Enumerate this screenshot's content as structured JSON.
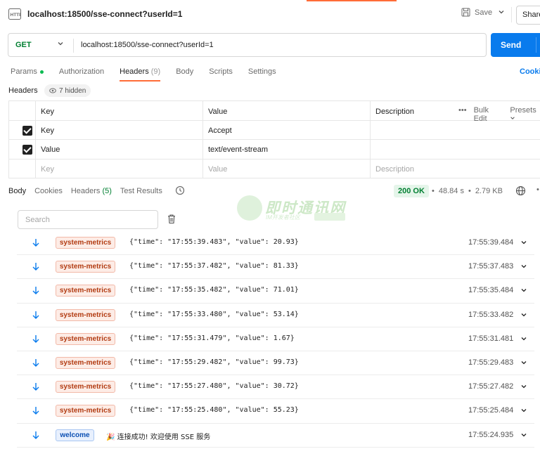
{
  "request": {
    "title": "localhost:18500/sse-connect?userId=1",
    "save_label": "Save",
    "share_label": "Share",
    "method": "GET",
    "url": "localhost:18500/sse-connect?userId=1",
    "send_label": "Send"
  },
  "req_tabs": [
    {
      "label": "Params",
      "count": "",
      "dot": true
    },
    {
      "label": "Authorization",
      "count": ""
    },
    {
      "label": "Headers",
      "count": "(9)",
      "active": true
    },
    {
      "label": "Body",
      "count": ""
    },
    {
      "label": "Scripts",
      "count": ""
    },
    {
      "label": "Settings",
      "count": ""
    }
  ],
  "cookies_label": "Cookie",
  "headers_section": {
    "label": "Headers",
    "hidden": "7 hidden",
    "columns": {
      "key": "Key",
      "value": "Value",
      "description": "Description"
    },
    "bulk_edit": "Bulk Edit",
    "presets": "Presets",
    "rows": [
      {
        "key": "Key",
        "value": "Accept",
        "checked": true
      },
      {
        "key": "Value",
        "value": "text/event-stream",
        "checked": true
      }
    ],
    "placeholder": {
      "key": "Key",
      "value": "Value",
      "description": "Description"
    }
  },
  "response": {
    "tabs": [
      {
        "label": "Body",
        "count": ""
      },
      {
        "label": "Cookies",
        "count": ""
      },
      {
        "label": "Headers",
        "count": "(5)"
      },
      {
        "label": "Test Results",
        "count": ""
      }
    ],
    "status": "200 OK",
    "time": "48.84 s",
    "size": "2.79 KB",
    "search_placeholder": "Search"
  },
  "watermark": {
    "text": "即时通讯网",
    "sub": "IM开发者社区"
  },
  "events": [
    {
      "type": "system-metrics",
      "data": "{\"time\": \"17:55:39.483\", \"value\": 20.93}",
      "time": "17:55:39.484"
    },
    {
      "type": "system-metrics",
      "data": "{\"time\": \"17:55:37.482\", \"value\": 81.33}",
      "time": "17:55:37.483"
    },
    {
      "type": "system-metrics",
      "data": "{\"time\": \"17:55:35.482\", \"value\": 71.01}",
      "time": "17:55:35.484"
    },
    {
      "type": "system-metrics",
      "data": "{\"time\": \"17:55:33.480\", \"value\": 53.14}",
      "time": "17:55:33.482"
    },
    {
      "type": "system-metrics",
      "data": "{\"time\": \"17:55:31.479\", \"value\": 1.67}",
      "time": "17:55:31.481"
    },
    {
      "type": "system-metrics",
      "data": "{\"time\": \"17:55:29.482\", \"value\": 99.73}",
      "time": "17:55:29.483"
    },
    {
      "type": "system-metrics",
      "data": "{\"time\": \"17:55:27.480\", \"value\": 30.72}",
      "time": "17:55:27.482"
    },
    {
      "type": "system-metrics",
      "data": "{\"time\": \"17:55:25.480\", \"value\": 55.23}",
      "time": "17:55:25.484"
    },
    {
      "type": "welcome",
      "data": "🎉 连接成功! 欢迎使用 SSE 服务",
      "time": "17:55:24.935"
    }
  ],
  "colors": {
    "accent": "#ff6c37",
    "send": "#097bed",
    "ok": "#007f31"
  }
}
